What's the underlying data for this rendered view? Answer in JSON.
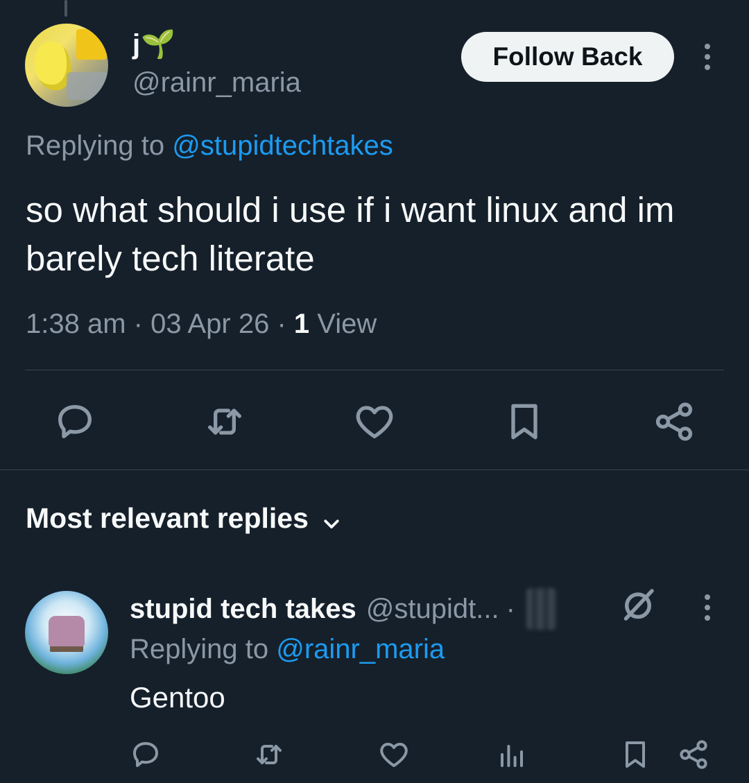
{
  "tweet": {
    "author": {
      "display_name": "j🌱",
      "handle": "@rainr_maria"
    },
    "follow_label": "Follow Back",
    "replying_prefix": "Replying to ",
    "replying_to": "@stupidtechtakes",
    "text": "so what should i use if i want linux and im barely tech literate",
    "time": "1:38 am",
    "date": "03 Apr 26",
    "views_count": "1",
    "views_label": "View",
    "actions": [
      "reply-icon",
      "retweet-icon",
      "like-icon",
      "bookmark-icon",
      "share-icon"
    ]
  },
  "replies": {
    "sort_label": "Most relevant replies",
    "items": [
      {
        "display_name": "stupid tech takes",
        "handle": "@stupidt...",
        "replying_prefix": "Replying to ",
        "replying_to": "@rainr_maria",
        "text": "Gentoo",
        "actions": [
          "reply-icon",
          "retweet-icon",
          "like-icon",
          "views-icon",
          "bookmark-icon",
          "share-icon"
        ]
      }
    ]
  },
  "colors": {
    "background": "#15202b",
    "text": "#f7f9f9",
    "secondary": "#8b98a5",
    "accent": "#1d9bf0",
    "divider": "#38444d"
  }
}
